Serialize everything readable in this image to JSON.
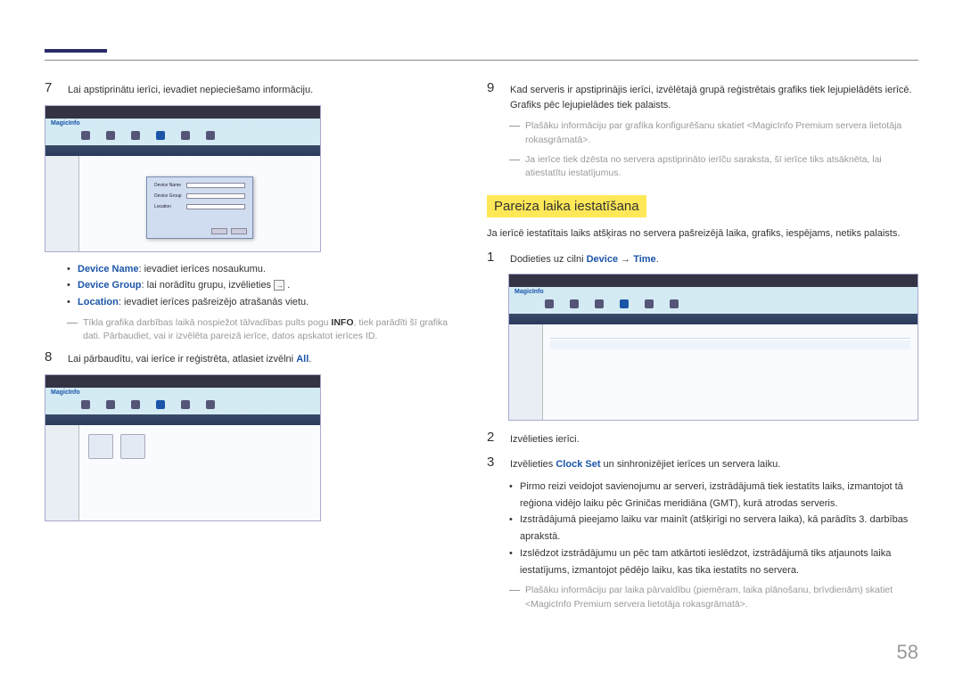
{
  "pageNumber": "58",
  "left": {
    "step7": {
      "num": "7",
      "text": "Lai apstiprinātu ierīci, ievadiet nepieciešamo informāciju."
    },
    "dialog": {
      "row1": "Device Name",
      "row2": "Device Group",
      "row3": "Location"
    },
    "logo": "MagicInfo",
    "bullets": {
      "b1_label": "Device Name",
      "b1_text": ": ievadiet ierīces nosaukumu.",
      "b2_label": "Device Group",
      "b2_text": ": lai norādītu grupu, izvēlieties ",
      "b2_after": " .",
      "b3_label": "Location",
      "b3_text": ": ievadiet ierīces pašreizējo atrašanās vietu."
    },
    "note7": {
      "pre": "Tīkla grafika darbības laikā nospiežot tālvadības pults pogu ",
      "bold": "INFO",
      "post": ", tiek parādīti šī grafika dati. Pārbaudiet, vai ir izvēlēta pareizā ierīce, datos apskatot ierīces ID."
    },
    "step8": {
      "num": "8",
      "pre": "Lai pārbaudītu, vai ierīce ir reģistrēta, atlasiet izvēlni ",
      "bold": "All",
      "post": "."
    }
  },
  "right": {
    "step9": {
      "num": "9",
      "text": "Kad serveris ir apstiprinājis ierīci, izvēlētajā grupā reģistrētais grafiks tiek lejupielādēts ierīcē. Grafiks pēc lejupielādes tiek palaists."
    },
    "note9a": "Plašāku informāciju par grafika konfigurēšanu skatiet <MagicInfo Premium servera lietotāja rokasgrāmatā>.",
    "note9b": "Ja ierīce tiek dzēsta no servera apstiprināto ierīču saraksta, šī ierīce tiks atsāknēta, lai atiestatītu iestatījumus.",
    "subhead": "Pareiza laika iestatīšana",
    "intro": "Ja ierīcē iestatītais laiks atšķiras no servera pašreizējā laika, grafiks, iespējams, netiks palaists.",
    "step1": {
      "num": "1",
      "pre": "Dodieties uz cilni ",
      "bold1": "Device",
      "arrow": " → ",
      "bold2": "Time",
      "post": "."
    },
    "logo": "MagicInfo",
    "step2": {
      "num": "2",
      "text": "Izvēlieties ierīci."
    },
    "step3": {
      "num": "3",
      "pre": "Izvēlieties ",
      "bold": "Clock Set",
      "post": " un sinhronizējiet ierīces un servera laiku."
    },
    "bullets": {
      "b1": "Pirmo reizi veidojot savienojumu ar serveri, izstrādājumā tiek iestatīts laiks, izmantojot tā reģiona vidējo laiku pēc Griničas meridiāna (GMT), kurā atrodas serveris.",
      "b2": "Izstrādājumā pieejamo laiku var mainīt (atšķirīgi no servera laika), kā parādīts 3. darbības aprakstā.",
      "b3": "Izslēdzot izstrādājumu un pēc tam atkārtoti ieslēdzot, izstrādājumā tiks atjaunots laika iestatījums, izmantojot pēdējo laiku, kas tika iestatīts no servera."
    },
    "noteTime": "Plašāku informāciju par laika pārvaldību (piemēram, laika plānošanu, brīvdienām) skatiet <MagicInfo Premium servera lietotāja rokasgrāmatā>."
  }
}
